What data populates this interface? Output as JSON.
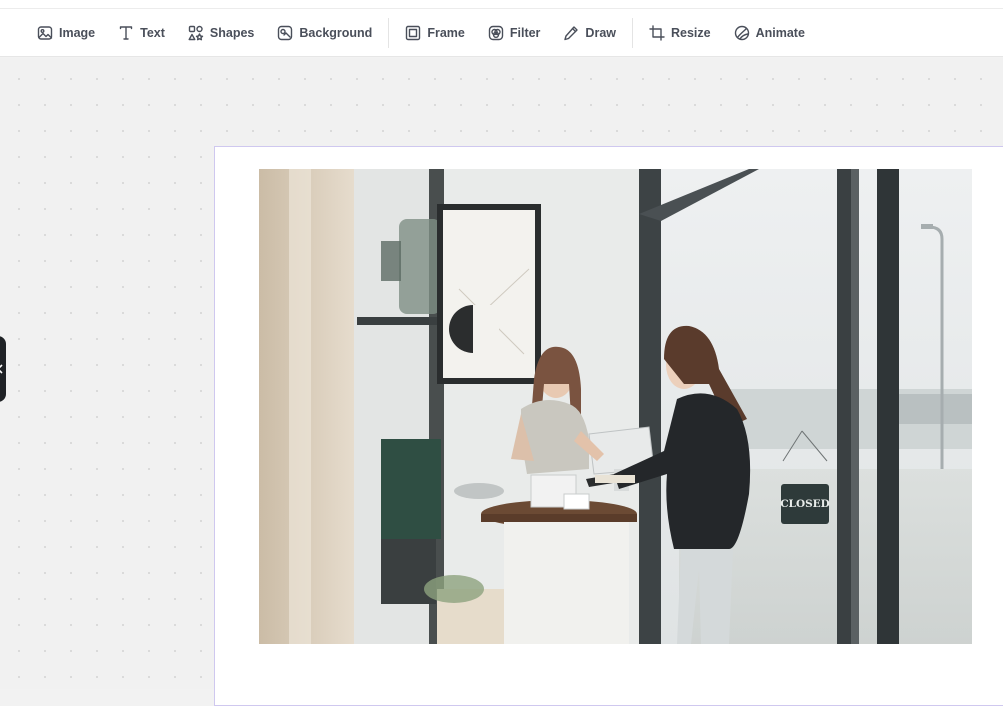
{
  "toolbar": {
    "tools": [
      {
        "label": "Image",
        "icon": "image-icon"
      },
      {
        "label": "Text",
        "icon": "text-icon"
      },
      {
        "label": "Shapes",
        "icon": "shapes-icon"
      },
      {
        "label": "Background",
        "icon": "background-icon"
      },
      {
        "label": "Frame",
        "icon": "frame-icon"
      },
      {
        "label": "Filter",
        "icon": "filter-icon"
      },
      {
        "label": "Draw",
        "icon": "pencil-icon"
      },
      {
        "label": "Resize",
        "icon": "crop-icon"
      },
      {
        "label": "Animate",
        "icon": "animate-icon"
      }
    ]
  },
  "canvas": {
    "photo": {
      "sign_text": "CLOSED",
      "alt_subject": "shop counter with two women at a payment terminal"
    }
  },
  "colors": {
    "accent_border": "#cfc8ef",
    "toolbar_text": "#4a4f5a",
    "handle": "#1f2226"
  }
}
